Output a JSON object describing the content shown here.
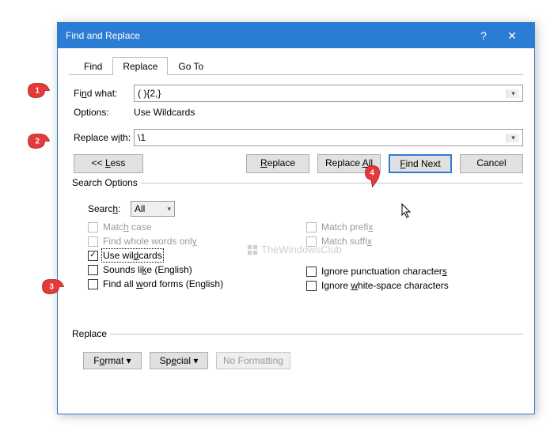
{
  "title": "Find and Replace",
  "tabs": {
    "find": "Find",
    "replace": "Replace",
    "goto": "Go To"
  },
  "labels": {
    "findwhat_pre": "Fi",
    "findwhat_u": "n",
    "findwhat_post": "d what:",
    "options": "Options:",
    "repwith_pre": "Replace w",
    "repwith_u": "i",
    "repwith_post": "th:",
    "searchopts": "Search Options",
    "search_pre": "Searc",
    "search_u": "h",
    "search_post": ":",
    "replaceGroup": "Replace"
  },
  "values": {
    "find": "( ){2,}",
    "options_detail": "Use Wildcards",
    "replace": "\\1",
    "searchSel": "All"
  },
  "buttons": {
    "less": "<<  Less",
    "replace": "Replace",
    "replaceAll": "Replace All",
    "findNext": "Find Next",
    "cancel": "Cancel",
    "format": "Format",
    "special": "Special",
    "noformat": "No Formatting"
  },
  "checks": {
    "matchcase": "Match case",
    "whole": "Find whole words only",
    "wildcards": "Use wildcards",
    "sounds": "Sounds like (English)",
    "wordforms": "Find all word forms (English)",
    "prefix": "Match prefix",
    "suffix": "Match suffix",
    "ignpunc": "Ignore punctuation characters",
    "ignws": "Ignore white-space characters"
  },
  "watermark": "TheWindowsClub",
  "callouts": {
    "1": "1",
    "2": "2",
    "3": "3",
    "4": "4"
  }
}
